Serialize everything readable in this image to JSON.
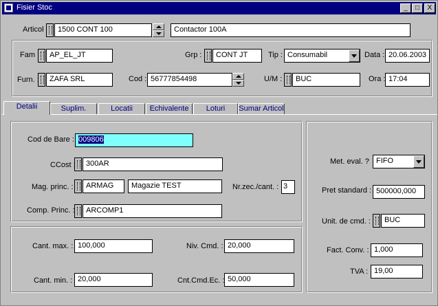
{
  "window": {
    "title": "Fisier Stoc",
    "buttons": {
      "minimize": "_",
      "maximize": "□",
      "close": "X"
    }
  },
  "articol": {
    "label": "Articol",
    "code": "1500 CONT 100",
    "description": "Contactor 100A"
  },
  "header": {
    "fam": {
      "label": "Fam :",
      "value": "AP_EL_JT"
    },
    "grp": {
      "label": "Grp :",
      "value": "CONT JT"
    },
    "tip": {
      "label": "Tip :",
      "value": "Consumabil"
    },
    "data": {
      "label": "Data :",
      "value": "20.06.2003"
    },
    "furn": {
      "label": "Furn. :",
      "value": "ZAFA SRL"
    },
    "cod": {
      "label": "Cod :",
      "value": "56777854498"
    },
    "um": {
      "label": "U/M :",
      "value": "BUC"
    },
    "ora": {
      "label": "Ora :",
      "value": "17:04"
    }
  },
  "tabs": [
    "Detalii",
    "Suplim.",
    "Locatii",
    "Echivalente",
    "Loturi",
    "Sumar Articol"
  ],
  "detalii": {
    "cod_bare": {
      "label": "Cod de Bare :",
      "value": "009806"
    },
    "ccost": {
      "label": "CCost :",
      "value": "300AR"
    },
    "mag": {
      "label": "Mag. princ. :",
      "code": "ARMAG",
      "name": "Magazie TEST"
    },
    "nrzec": {
      "label": "Nr.zec./cant. :",
      "value": "3"
    },
    "comp": {
      "label": "Comp. Princ. :",
      "value": "ARCOMP1"
    },
    "cant_max": {
      "label": "Cant. max. :",
      "value": "100,000"
    },
    "niv_cmd": {
      "label": "Niv. Cmd. :",
      "value": "20,000"
    },
    "cant_min": {
      "label": "Cant. min. :",
      "value": "20,000"
    },
    "cnt_cmd_ec": {
      "label": "Cnt.Cmd.Ec. :",
      "value": "50,000"
    },
    "met_eval": {
      "label": "Met. eval. ?",
      "value": "FIFO"
    },
    "pret_std": {
      "label": "Pret standard :",
      "value": "500000,000"
    },
    "unit_cmd": {
      "label": "Unit. de cmd. :",
      "value": "BUC"
    },
    "fact_conv": {
      "label": "Fact. Conv. :",
      "value": "1,000"
    },
    "tva": {
      "label": "TVA :",
      "value": "19,00"
    }
  }
}
